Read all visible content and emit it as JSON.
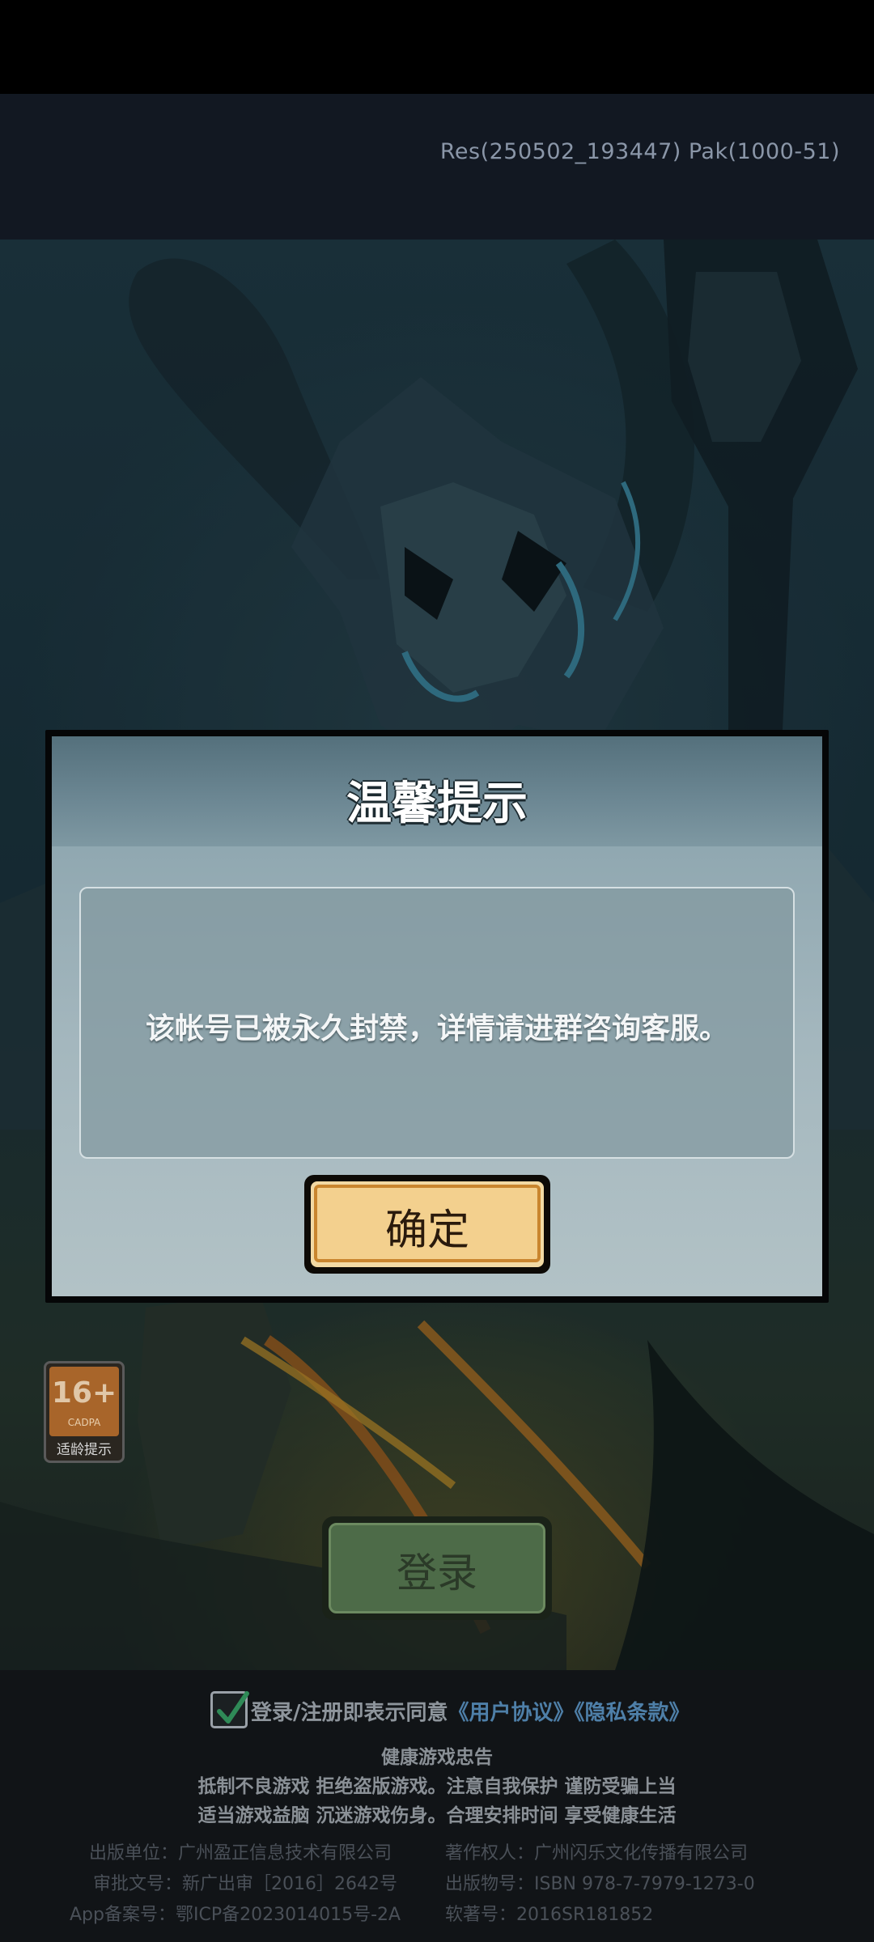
{
  "header": {
    "version": "Res(250502_193447) Pak(1000-51)"
  },
  "age_rating": {
    "age": "16+",
    "org": "CADPA",
    "caption": "适龄提示"
  },
  "login_button": {
    "label": "登录"
  },
  "dialog": {
    "title": "温馨提示",
    "message": "该帐号已被永久封禁，详情请进群咨询客服。",
    "confirm_label": "确定"
  },
  "agreement": {
    "checked": true,
    "text": "登录/注册即表示同意",
    "user_agreement": "《用户协议》",
    "privacy_policy": "《隐私条款》"
  },
  "health_advice": {
    "title": "健康游戏忠告",
    "line1": "抵制不良游戏  拒绝盗版游戏。注意自我保护  谨防受骗上当",
    "line2": "适当游戏益脑  沉迷游戏伤身。合理安排时间  享受健康生活"
  },
  "publishing": {
    "publisher": "出版单位：广州盈正信息技术有限公司",
    "approval": "审批文号：新广出审［2016］2642号",
    "icp": "App备案号：鄂ICP备2023014015号-2A",
    "copyright_owner": "著作权人：广州闪乐文化传播有限公司",
    "isbn": "出版物号：ISBN 978-7-7979-1273-0",
    "software_reg": "软著号：2016SR181852"
  }
}
